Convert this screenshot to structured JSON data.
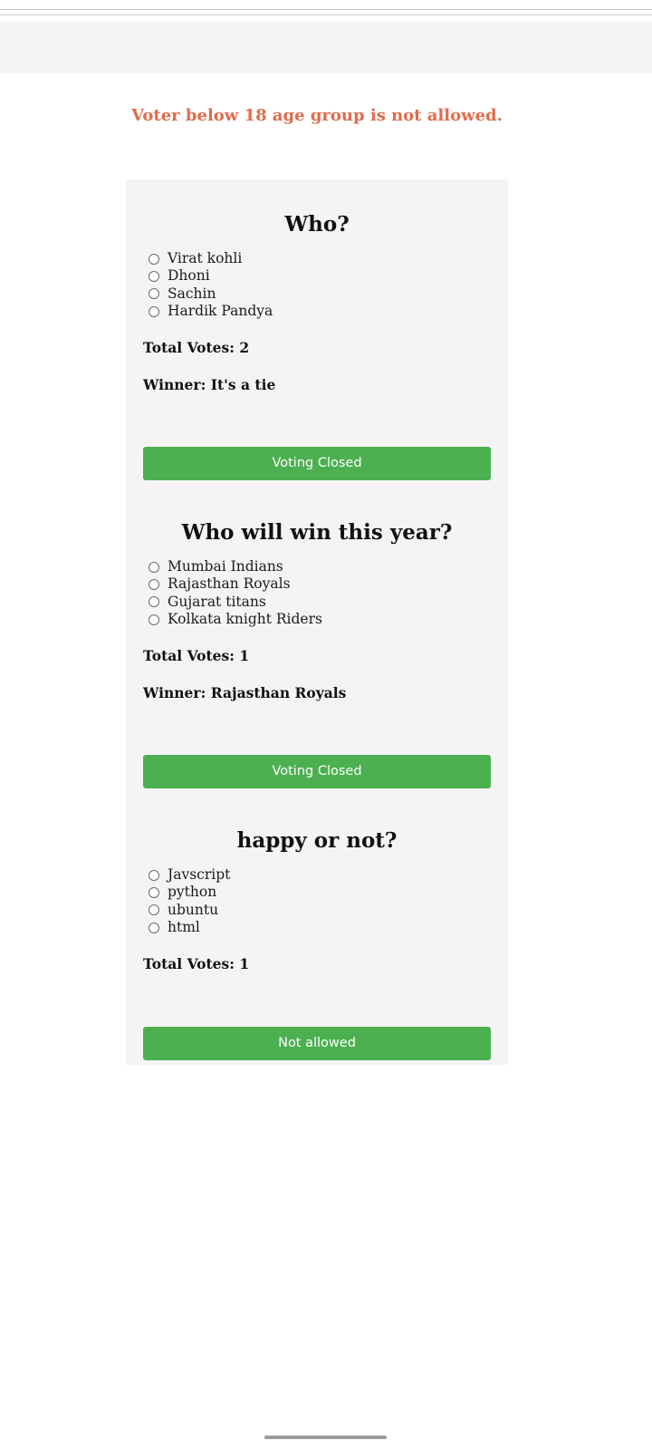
{
  "warning": "Voter below 18 age group is not allowed.",
  "polls": [
    {
      "title": "Who?",
      "options": [
        "Virat kohli",
        "Dhoni",
        "Sachin",
        "Hardik Pandya"
      ],
      "total_votes": "Total Votes: 2",
      "winner": "Winner: It's a tie",
      "button_label": "Voting Closed"
    },
    {
      "title": "Who will win this year?",
      "options": [
        "Mumbai Indians",
        "Rajasthan Royals",
        "Gujarat titans",
        "Kolkata knight Riders"
      ],
      "total_votes": "Total Votes: 1",
      "winner": "Winner: Rajasthan Royals",
      "button_label": "Voting Closed"
    },
    {
      "title": "happy or not?",
      "options": [
        "Javscript",
        "python",
        "ubuntu",
        "html"
      ],
      "total_votes": "Total Votes: 1",
      "button_label": "Not allowed"
    }
  ],
  "colors": {
    "warning": "#e06c4c",
    "button": "#4caf50",
    "card_background": "#f5f4f5"
  }
}
